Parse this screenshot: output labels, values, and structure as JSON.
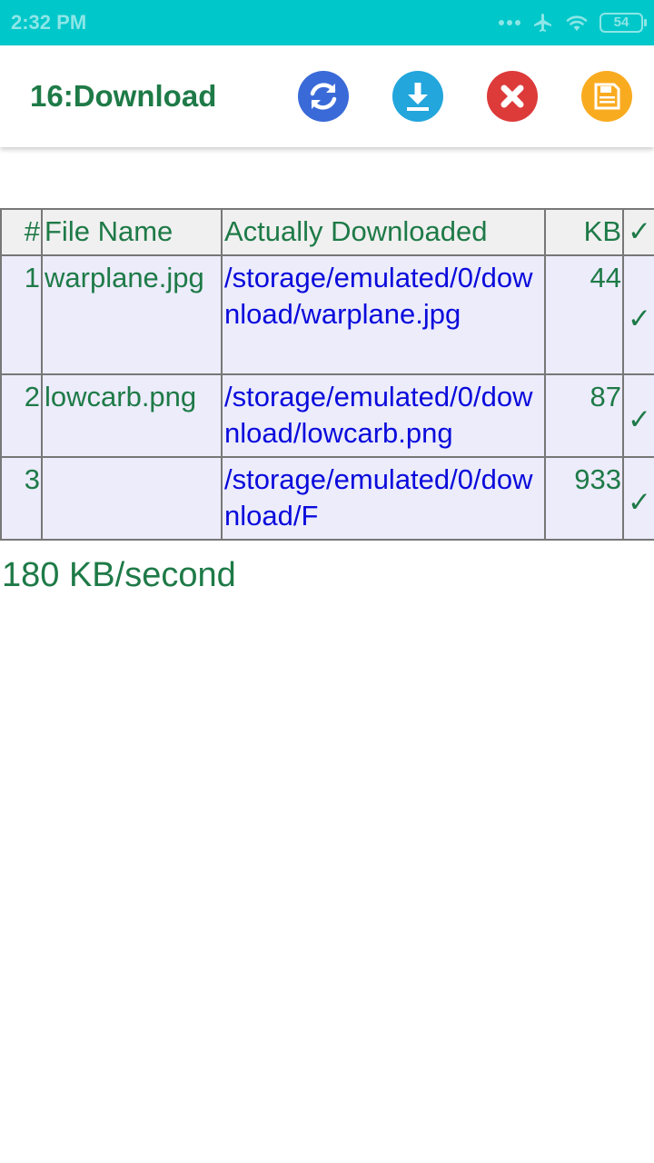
{
  "status_bar": {
    "time": "2:32 PM",
    "battery": "54"
  },
  "app_bar": {
    "title": "16:Download",
    "icons": [
      "refresh-icon",
      "download-icon",
      "cancel-icon",
      "save-icon"
    ]
  },
  "table": {
    "headers": [
      "#",
      "File Name",
      "Actually Downloaded",
      "KB",
      "✓"
    ],
    "rows": [
      {
        "num": "1",
        "name": "warplane.jpg",
        "path": "/storage/emulated/0/download/warplane.jpg",
        "kb": "44",
        "check": "✓"
      },
      {
        "num": "2",
        "name": "lowcarb.png",
        "path": "/storage/emulated/0/download/lowcarb.png",
        "kb": "87",
        "check": "✓"
      },
      {
        "num": "3",
        "name": "",
        "path": "/storage/emulated/0/download/F",
        "kb": "933",
        "check": "✓"
      }
    ]
  },
  "speed": "180 KB/second",
  "colors": {
    "status_bar": "#00c7c9",
    "title_green": "#1e7a47",
    "path_blue": "#0a0adc",
    "row_bg": "#ececfb",
    "header_bg": "#f0f0f0"
  }
}
